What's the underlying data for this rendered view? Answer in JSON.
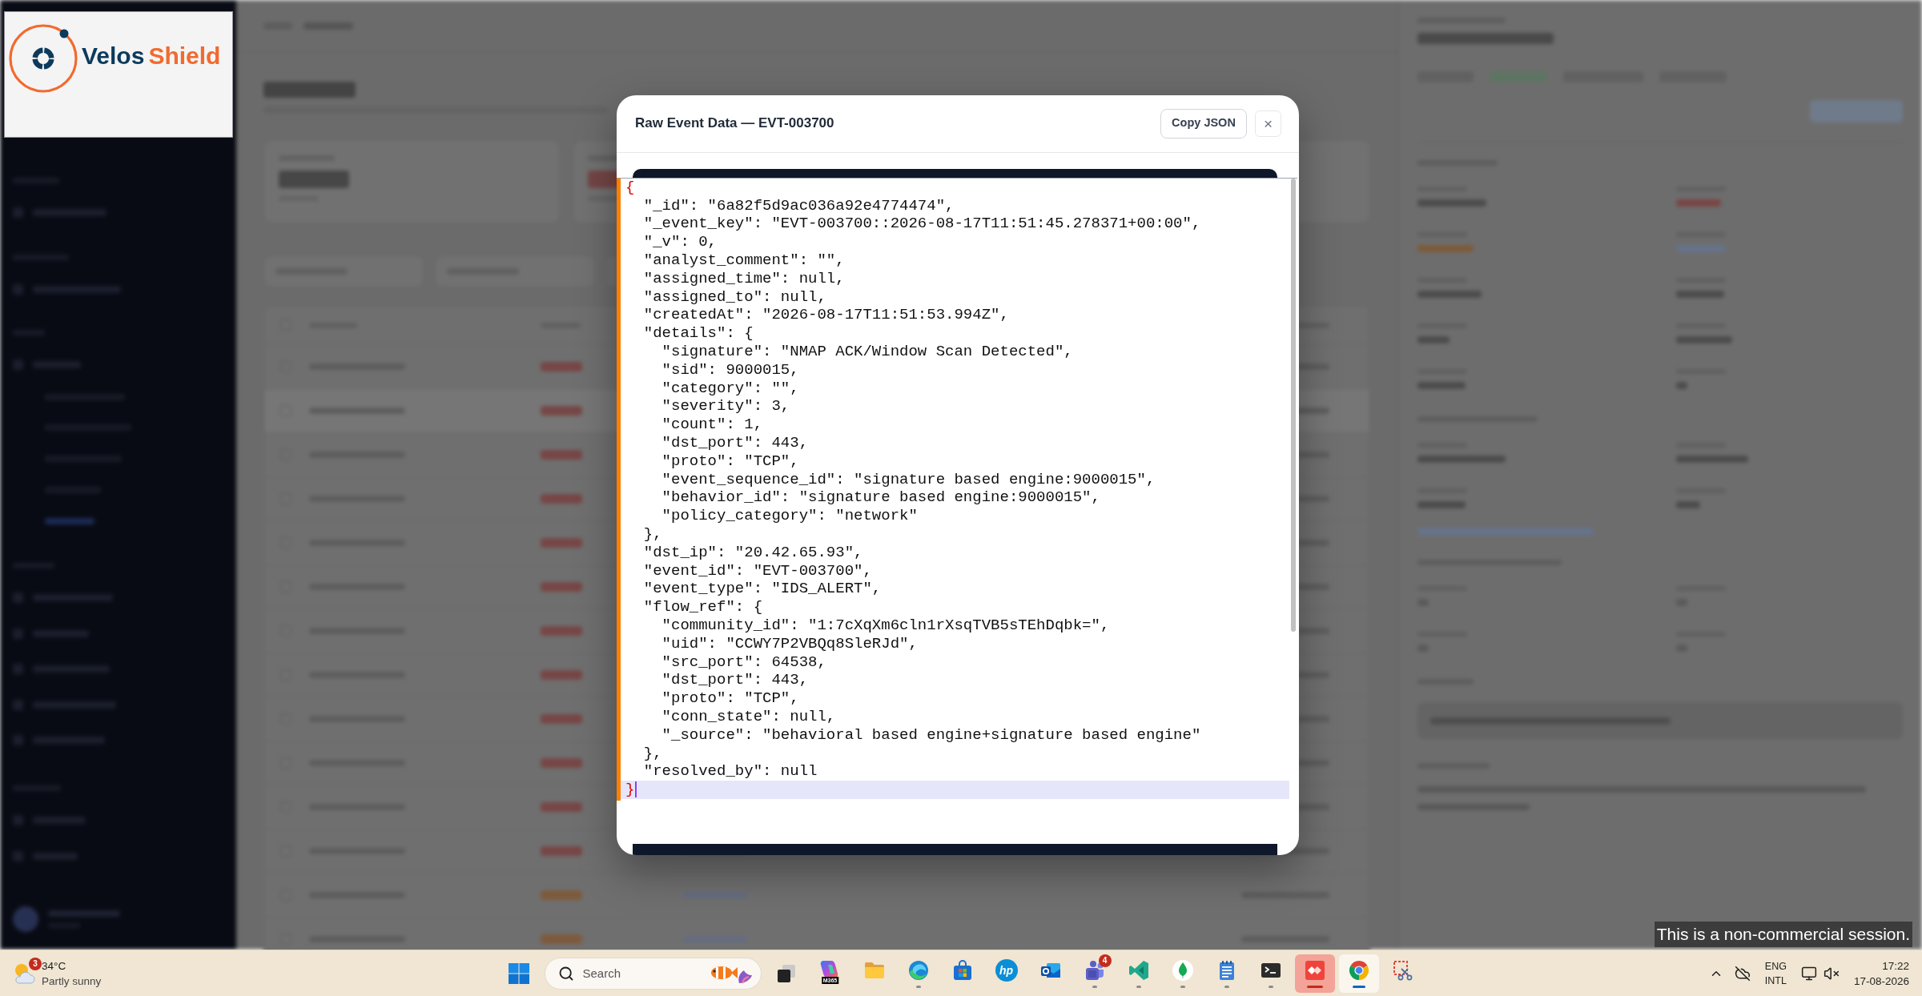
{
  "logo": {
    "words": [
      {
        "text": "Velos",
        "color": "#0b3a5c"
      },
      {
        "text": "Shield",
        "color": "#f26a2e"
      }
    ]
  },
  "modal": {
    "title": "Raw Event Data — EVT-003700",
    "buttons": [
      {
        "kind": "copy",
        "label": "Copy JSON"
      },
      {
        "kind": "close",
        "label": "×"
      }
    ],
    "editor": {
      "lines": [
        {
          "kind": "brace",
          "text": "{",
          "current": false
        },
        {
          "kind": "code",
          "text": "  \"_id\": \"6a82f5d9ac036a92e4774474\",",
          "current": false
        },
        {
          "kind": "code",
          "text": "  \"_event_key\": \"EVT-003700::2026-08-17T11:51:45.278371+00:00\",",
          "current": false
        },
        {
          "kind": "code",
          "text": "  \"_v\": 0,",
          "current": false
        },
        {
          "kind": "code",
          "text": "  \"analyst_comment\": \"\",",
          "current": false
        },
        {
          "kind": "code",
          "text": "  \"assigned_time\": null,",
          "current": false
        },
        {
          "kind": "code",
          "text": "  \"assigned_to\": null,",
          "current": false
        },
        {
          "kind": "code",
          "text": "  \"createdAt\": \"2026-08-17T11:51:53.994Z\",",
          "current": false
        },
        {
          "kind": "code",
          "text": "  \"details\": {",
          "current": false
        },
        {
          "kind": "code",
          "text": "    \"signature\": \"NMAP ACK/Window Scan Detected\",",
          "current": false
        },
        {
          "kind": "code",
          "text": "    \"sid\": 9000015,",
          "current": false
        },
        {
          "kind": "code",
          "text": "    \"category\": \"\",",
          "current": false
        },
        {
          "kind": "code",
          "text": "    \"severity\": 3,",
          "current": false
        },
        {
          "kind": "code",
          "text": "    \"count\": 1,",
          "current": false
        },
        {
          "kind": "code",
          "text": "    \"dst_port\": 443,",
          "current": false
        },
        {
          "kind": "code",
          "text": "    \"proto\": \"TCP\",",
          "current": false
        },
        {
          "kind": "code",
          "text": "    \"event_sequence_id\": \"signature based engine:9000015\",",
          "current": false
        },
        {
          "kind": "code",
          "text": "    \"behavior_id\": \"signature based engine:9000015\",",
          "current": false
        },
        {
          "kind": "code",
          "text": "    \"policy_category\": \"network\"",
          "current": false
        },
        {
          "kind": "code",
          "text": "  },",
          "current": false
        },
        {
          "kind": "code",
          "text": "  \"dst_ip\": \"20.42.65.93\",",
          "current": false
        },
        {
          "kind": "code",
          "text": "  \"event_id\": \"EVT-003700\",",
          "current": false
        },
        {
          "kind": "code",
          "text": "  \"event_type\": \"IDS_ALERT\",",
          "current": false
        },
        {
          "kind": "code",
          "text": "  \"flow_ref\": {",
          "current": false
        },
        {
          "kind": "code",
          "text": "    \"community_id\": \"1:7cXqXm6cln1rXsqTVB5sTEhDqbk=\",",
          "current": false
        },
        {
          "kind": "code",
          "text": "    \"uid\": \"CCWY7P2VBQq8SleRJd\",",
          "current": false
        },
        {
          "kind": "code",
          "text": "    \"src_port\": 64538,",
          "current": false
        },
        {
          "kind": "code",
          "text": "    \"dst_port\": 443,",
          "current": false
        },
        {
          "kind": "code",
          "text": "    \"proto\": \"TCP\",",
          "current": false
        },
        {
          "kind": "code",
          "text": "    \"conn_state\": null,",
          "current": false
        },
        {
          "kind": "code",
          "text": "    \"_source\": \"behavioral based engine+signature based engine\"",
          "current": false
        },
        {
          "kind": "code",
          "text": "  },",
          "current": false
        },
        {
          "kind": "code",
          "text": "  \"resolved_by\": null",
          "current": false
        },
        {
          "kind": "brace",
          "text": "}",
          "current": true
        }
      ]
    }
  },
  "session_notice": "This is a non-commercial session.",
  "taskbar": {
    "weather": {
      "badge": "3",
      "temperature": "34°C",
      "condition": "Partly sunny"
    },
    "search": {
      "placeholder": "Search"
    },
    "apps": [
      {
        "kind": "gradient-tile",
        "label": "M365",
        "running": false,
        "selected": false,
        "flashing": false
      },
      {
        "kind": "folder",
        "running": false,
        "selected": false,
        "flashing": false
      },
      {
        "kind": "wave-globe",
        "running": true,
        "selected": false,
        "flashing": false
      },
      {
        "kind": "bag",
        "running": false,
        "selected": false,
        "flashing": false
      },
      {
        "kind": "round-logo",
        "label": "hp",
        "running": false,
        "selected": false,
        "flashing": false
      },
      {
        "kind": "envelope",
        "running": false,
        "selected": false,
        "flashing": false
      },
      {
        "kind": "people",
        "badge": "4",
        "running": true,
        "selected": false,
        "flashing": false
      },
      {
        "kind": "ribbon",
        "running": true,
        "selected": false,
        "flashing": false
      },
      {
        "kind": "leaf",
        "running": true,
        "selected": false,
        "flashing": false
      },
      {
        "kind": "notepad",
        "running": true,
        "selected": false,
        "flashing": false
      },
      {
        "kind": "terminal",
        "running": true,
        "selected": false,
        "flashing": false
      },
      {
        "kind": "diamonds",
        "running": true,
        "selected": false,
        "flashing": true
      },
      {
        "kind": "tricolor",
        "running": true,
        "selected": true,
        "flashing": false
      },
      {
        "kind": "snip",
        "running": false,
        "selected": false,
        "flashing": false
      }
    ],
    "tray": {
      "language": "ENG",
      "layout": "INTL",
      "time": "17:22",
      "date": "17-08-2026"
    }
  }
}
